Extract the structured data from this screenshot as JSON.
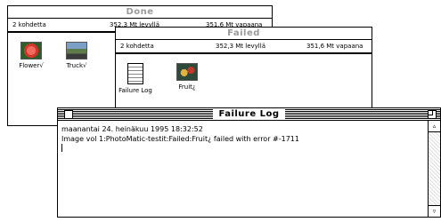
{
  "done_window": {
    "title": "Done",
    "items_count": "2 kohdetta",
    "disk_used": "352,3 Mt levyllä",
    "disk_free": "351,6 Mt vapaana",
    "icons": [
      {
        "label": "Flower√",
        "icon": "flower-image-icon"
      },
      {
        "label": "Truck√",
        "icon": "truck-image-icon"
      }
    ]
  },
  "failed_window": {
    "title": "Failed",
    "items_count": "2 kohdetta",
    "disk_used": "352,3 Mt levyllä",
    "disk_free": "351,6 Mt vapaana",
    "icons": [
      {
        "label": "Failure Log",
        "icon": "document-icon"
      },
      {
        "label": "Fruit¿",
        "icon": "fruit-image-icon"
      }
    ]
  },
  "log_window": {
    "title": "Failure Log",
    "lines": [
      "maanantai 24. heinäkuu 1995 18:32:52",
      "Image vol 1:PhotoMatic-testit:Failed:Fruit¿ failed with error #-1711"
    ]
  },
  "colors": {
    "inactive_title": "#9a9a9a",
    "flower": "#d2362b",
    "truck": "#5e7b4a",
    "fruit": "#d97b2a"
  }
}
